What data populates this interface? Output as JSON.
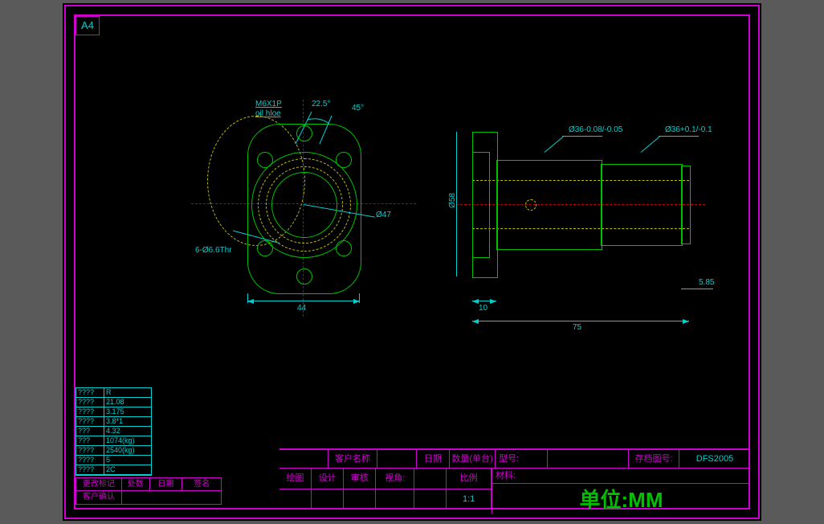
{
  "sheet_size": "A4",
  "front_view": {
    "thread_note": "M6X1P",
    "oil_hole_note": "oil hloe",
    "angle1": "22.5°",
    "angle2": "45°",
    "bolt_pattern": "6-Ø6.6Thr",
    "pcd_dia": "Ø47",
    "width": "44"
  },
  "side_view": {
    "flange_dia": "Ø58",
    "d1": "Ø36-0.08/-0.05",
    "d2": "Ø36+0.1/-0.1",
    "flange_thk": "10",
    "length": "75",
    "step": "5.85"
  },
  "data_table": [
    {
      "k": "????",
      "v": "R"
    },
    {
      "k": "????",
      "v": "21.08"
    },
    {
      "k": "????",
      "v": "3.175"
    },
    {
      "k": "????",
      "v": "3.8*1"
    },
    {
      "k": "???",
      "v": "4.32"
    },
    {
      "k": "???",
      "v": "1074(kg)"
    },
    {
      "k": "????",
      "v": "2540(kg)"
    },
    {
      "k": "????",
      "v": "5"
    },
    {
      "k": "????",
      "v": "2C"
    }
  ],
  "revision": {
    "mark": "更改标记",
    "qty": "处数",
    "date": "日期",
    "sign": "签名",
    "confirm": "客户确认"
  },
  "title_block": {
    "customer": "客户名称",
    "date": "日期",
    "qty_per_set": "数量(单台)",
    "model": "型号:",
    "archive": "存档图号:",
    "archive_no": "DFS2005",
    "material": "材料:",
    "drawn": "绘图",
    "design": "设计",
    "review": "审核",
    "angle": "视角:",
    "scale": "比例",
    "scale_val": "1:1",
    "unit": "单位:MM"
  }
}
